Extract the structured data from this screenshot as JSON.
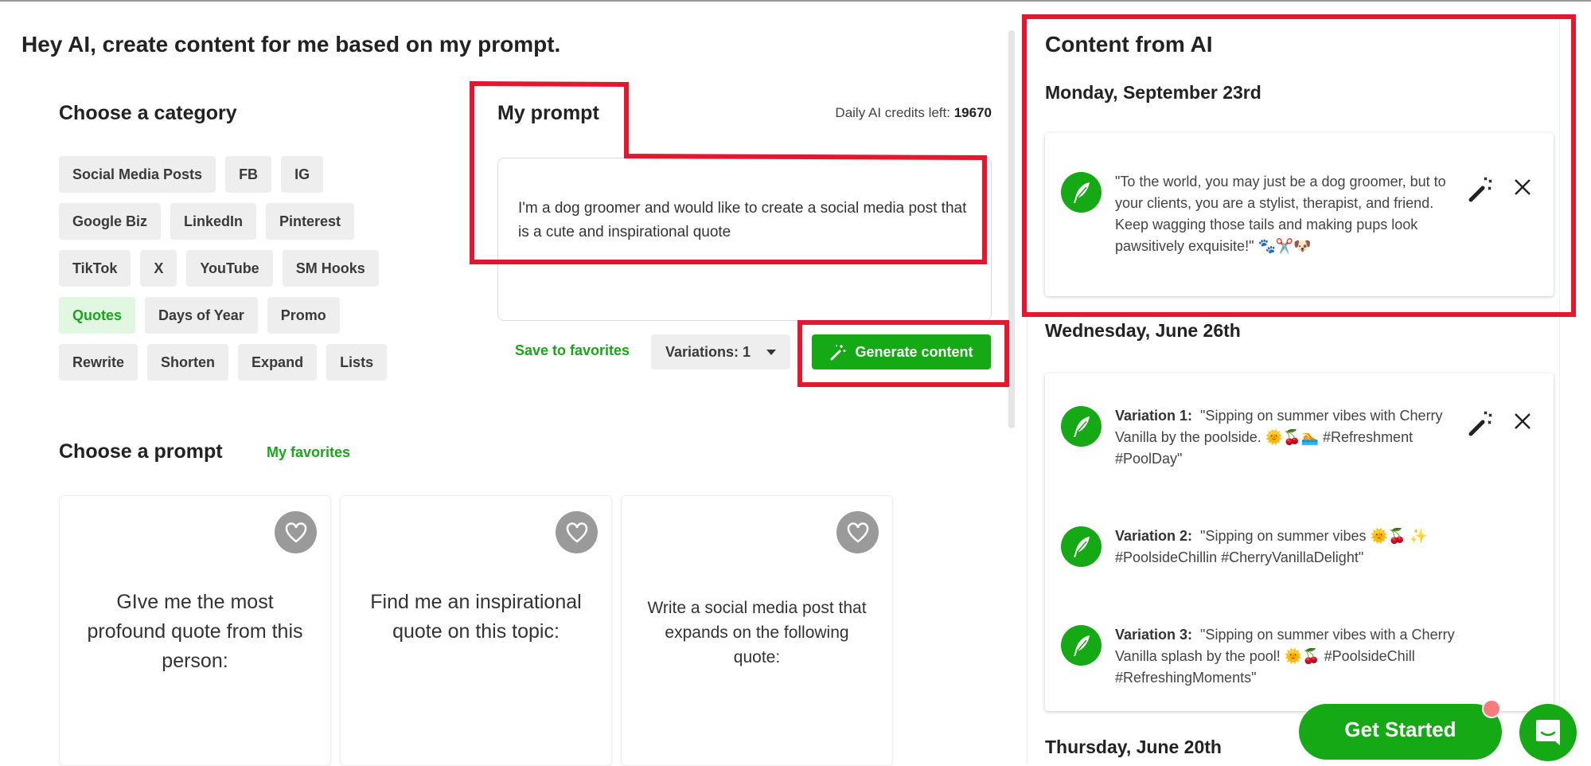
{
  "page_title": "Hey AI, create content for me based on my prompt.",
  "category": {
    "heading": "Choose a category",
    "rows": [
      [
        "Social Media Posts",
        "FB",
        "IG"
      ],
      [
        "Google Biz",
        "LinkedIn",
        "Pinterest"
      ],
      [
        "TikTok",
        "X",
        "YouTube",
        "SM Hooks"
      ],
      [
        "Quotes",
        "Days of Year",
        "Promo"
      ],
      [
        "Rewrite",
        "Shorten",
        "Expand",
        "Lists"
      ]
    ],
    "active": "Quotes"
  },
  "prompt": {
    "heading": "My prompt",
    "credits_label": "Daily AI credits left:",
    "credits_value": "19670",
    "text": "I'm a dog groomer and would like to create a social media post that is a cute and inspirational quote",
    "save_label": "Save to favorites",
    "variations_label": "Variations: 1",
    "generate_label": "Generate content"
  },
  "choose_prompt": {
    "heading": "Choose a prompt",
    "favorites_label": "My favorites",
    "cards": [
      "GIve me the most profound quote from this person:",
      "Find me an inspirational quote on this topic:",
      "Write a social media post that expands on the following quote:"
    ]
  },
  "content": {
    "heading": "Content from AI",
    "groups": [
      {
        "date": "Monday, September 23rd",
        "items": [
          {
            "label": "",
            "text": "\"To the world, you may just be a dog groomer, but to your clients, you are a stylist, therapist, and friend. Keep wagging those tails and making pups look pawsitively exquisite!\" 🐾✂️🐶"
          }
        ]
      },
      {
        "date": "Wednesday, June 26th",
        "items": [
          {
            "label": "Variation 1:",
            "text": "\"Sipping on summer vibes with Cherry Vanilla by the poolside. 🌞🍒🏊 #Refreshment #PoolDay\""
          },
          {
            "label": "Variation 2:",
            "text": "\"Sipping on summer vibes 🌞🍒 ✨ #PoolsideChillin #CherryVanillaDelight\""
          },
          {
            "label": "Variation 3:",
            "text": "\"Sipping on summer vibes with a Cherry Vanilla splash by the pool! 🌞🍒 #PoolsideChill #RefreshingMoments\""
          }
        ]
      },
      {
        "date": "Thursday, June 20th",
        "items": []
      }
    ]
  },
  "get_started_label": "Get Started",
  "colors": {
    "accent": "#16a916",
    "annotation": "#e5162e",
    "chip": "#eeeeee"
  }
}
